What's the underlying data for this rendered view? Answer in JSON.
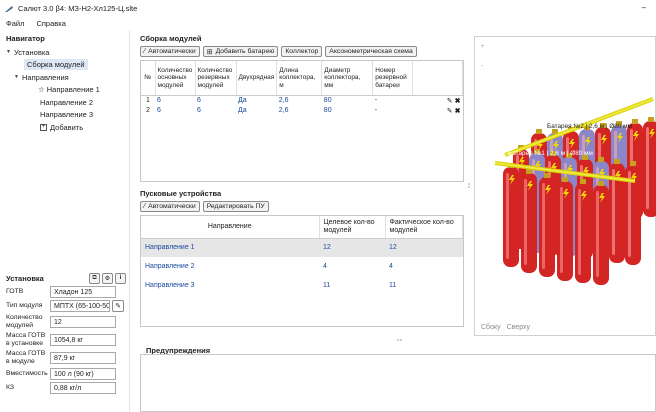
{
  "window": {
    "title": "Салют 3.0 β4: МЗ-Н2-Хл125-Ц.slte",
    "minimize": "–"
  },
  "menu": [
    "Файл",
    "Справка"
  ],
  "navigator": {
    "title": "Навигатор",
    "tree": {
      "root": "Установка",
      "assembly": "Сборка модулей",
      "directions": "Направления",
      "dir1": "Направление 1",
      "dir2": "Направление 2",
      "dir3": "Направление 3",
      "add": "Добавить"
    }
  },
  "installation": {
    "title": "Установка",
    "props": [
      {
        "label": "ГОТВ",
        "value": "Хладон 125"
      },
      {
        "label": "Тип модуля",
        "value": "МПТХ (65-100-50)"
      },
      {
        "label": "Количество модулей",
        "value": "12"
      },
      {
        "label": "Масса ГОТВ в установке",
        "value": "1054,8 кг"
      },
      {
        "label": "Масса ГОТВ в модуле",
        "value": "87,9 кг"
      },
      {
        "label": "Вместимость",
        "value": "100 л (90 кг)"
      },
      {
        "label": "КЗ",
        "value": "0,88 кг/л"
      }
    ]
  },
  "assembly": {
    "title": "Сборка модулей",
    "buttons": {
      "auto": "Автоматически",
      "add_battery": "Добавить батарею",
      "collector": "Коллектор",
      "axonometric": "Аксонометрическая схема"
    },
    "columns": [
      "№",
      "Количество основных модулей",
      "Количество резервных модулей",
      "Двухрядная",
      "Длина коллектора, м",
      "Диаметр коллектора, мм",
      "Номер резервной батареи"
    ],
    "rows": [
      [
        "1",
        "6",
        "6",
        "Да",
        "2,6",
        "80",
        "-"
      ],
      [
        "2",
        "6",
        "6",
        "Да",
        "2,6",
        "80",
        "-"
      ]
    ]
  },
  "launch": {
    "title": "Пусковые устройства",
    "buttons": {
      "auto": "Автоматически",
      "edit": "Редактировать ПУ"
    },
    "columns": [
      "Направление",
      "Целевое кол-во модулей",
      "Фактическое кол-во модулей"
    ],
    "rows": [
      [
        "Направление 1",
        "12",
        "12"
      ],
      [
        "Направление 2",
        "4",
        "4"
      ],
      [
        "Направление 3",
        "11",
        "11"
      ]
    ]
  },
  "viewer": {
    "label1": "Батарея №1 | 2,6 м | Ø80 мм",
    "label2": "Батарея №2 | 2,6 м | Ø80 мм",
    "views": [
      "Сбоку",
      "Сверху"
    ],
    "colors": {
      "cylinder_red": "#d42525",
      "cylinder_blue": "#8a86c8",
      "collector": "#e8e020"
    }
  },
  "warnings": {
    "title": "Предупреждения"
  }
}
